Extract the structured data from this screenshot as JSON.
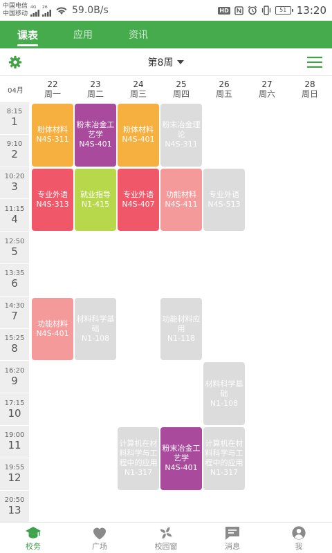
{
  "status_bar": {
    "carrier_1": "中国电信",
    "carrier_2": "中国移动",
    "net_badge_1": "4G",
    "net_badge_2": "26",
    "speed": "59.0B/s",
    "hd": "HD",
    "battery": "51",
    "time": "13:20"
  },
  "tabs": [
    {
      "label": "课表",
      "active": true
    },
    {
      "label": "应用",
      "active": false
    },
    {
      "label": "资讯",
      "active": false
    }
  ],
  "week_bar": {
    "week": "第8周",
    "settings_icon": "gear-icon",
    "menu_icon": "hamburger-icon"
  },
  "month": "04月",
  "days": [
    {
      "date": "22",
      "weekday": "周一"
    },
    {
      "date": "23",
      "weekday": "周二"
    },
    {
      "date": "24",
      "weekday": "周三"
    },
    {
      "date": "25",
      "weekday": "周四"
    },
    {
      "date": "26",
      "weekday": "周五"
    },
    {
      "date": "27",
      "weekday": "周六"
    },
    {
      "date": "28",
      "weekday": "周日"
    }
  ],
  "periods": [
    {
      "time": "8:15",
      "num": "1"
    },
    {
      "time": "9:10",
      "num": "2"
    },
    {
      "time": "10:20",
      "num": "3"
    },
    {
      "time": "11:15",
      "num": "4"
    },
    {
      "time": "12:50",
      "num": "5"
    },
    {
      "time": "13:35",
      "num": "6"
    },
    {
      "time": "14:30",
      "num": "7"
    },
    {
      "time": "15:25",
      "num": "8"
    },
    {
      "time": "16:20",
      "num": "9"
    },
    {
      "time": "17:15",
      "num": "10"
    },
    {
      "time": "19:00",
      "num": "11"
    },
    {
      "time": "19:55",
      "num": "12"
    },
    {
      "time": "20:50",
      "num": "13"
    }
  ],
  "courses": [
    {
      "day": 0,
      "start": 1,
      "span": 2,
      "name": "粉体材料",
      "room": "N4S-311",
      "color": "#f6b03f",
      "current": true
    },
    {
      "day": 1,
      "start": 1,
      "span": 2,
      "name": "粉末冶金工艺学",
      "room": "N4S-401",
      "color": "#a94a9c",
      "current": true
    },
    {
      "day": 2,
      "start": 1,
      "span": 2,
      "name": "粉体材料",
      "room": "N4S-401",
      "color": "#f6b03f",
      "current": true
    },
    {
      "day": 3,
      "start": 1,
      "span": 2,
      "name": "粉末冶金理论",
      "room": "N4S-311",
      "color": "#dcdcdc",
      "current": false
    },
    {
      "day": 0,
      "start": 3,
      "span": 2,
      "name": "专业外语",
      "room": "N4S-313",
      "color": "#f0586a",
      "current": true
    },
    {
      "day": 1,
      "start": 3,
      "span": 2,
      "name": "就业指导",
      "room": "N1-415",
      "color": "#b7d84b",
      "current": true
    },
    {
      "day": 2,
      "start": 3,
      "span": 2,
      "name": "专业外语",
      "room": "N4S-407",
      "color": "#f0586a",
      "current": true
    },
    {
      "day": 3,
      "start": 3,
      "span": 2,
      "name": "功能材料",
      "room": "N4S-411",
      "color": "#f59a9a",
      "current": true
    },
    {
      "day": 4,
      "start": 3,
      "span": 2,
      "name": "专业外语",
      "room": "N4S-513",
      "color": "#dcdcdc",
      "current": false
    },
    {
      "day": 0,
      "start": 7,
      "span": 2,
      "name": "功能材料",
      "room": "N4S-401",
      "color": "#f59a9a",
      "current": true
    },
    {
      "day": 1,
      "start": 7,
      "span": 2,
      "name": "材料科学基础",
      "room": "N1-108",
      "color": "#dcdcdc",
      "current": false
    },
    {
      "day": 3,
      "start": 7,
      "span": 2,
      "name": "功能材料应用",
      "room": "N1-118",
      "color": "#dcdcdc",
      "current": false
    },
    {
      "day": 4,
      "start": 9,
      "span": 2,
      "name": "材料科学基础",
      "room": "N1-108",
      "color": "#dcdcdc",
      "current": false
    },
    {
      "day": 2,
      "start": 11,
      "span": 2,
      "name": "计算机在材料科学与工程中的应用",
      "room": "N1-317",
      "color": "#dcdcdc",
      "current": false
    },
    {
      "day": 3,
      "start": 11,
      "span": 2,
      "name": "粉末冶金工艺学",
      "room": "N4S-401",
      "color": "#a94a9c",
      "current": true
    },
    {
      "day": 4,
      "start": 11,
      "span": 2,
      "name": "计算机在材料科学与工程中的应用",
      "room": "N1-317",
      "color": "#dcdcdc",
      "current": false
    }
  ],
  "nav": [
    {
      "label": "校务",
      "icon": "graduation-cap-icon",
      "active": true
    },
    {
      "label": "广场",
      "icon": "heart-icon",
      "active": false
    },
    {
      "label": "校园窗",
      "icon": "pinwheel-icon",
      "active": false
    },
    {
      "label": "消息",
      "icon": "chat-icon",
      "active": false
    },
    {
      "label": "我",
      "icon": "person-icon",
      "active": false
    }
  ],
  "colors": {
    "brand": "#46ab4c",
    "nav_active": "#3fa34d",
    "inactive_course": "#dcdcdc"
  }
}
